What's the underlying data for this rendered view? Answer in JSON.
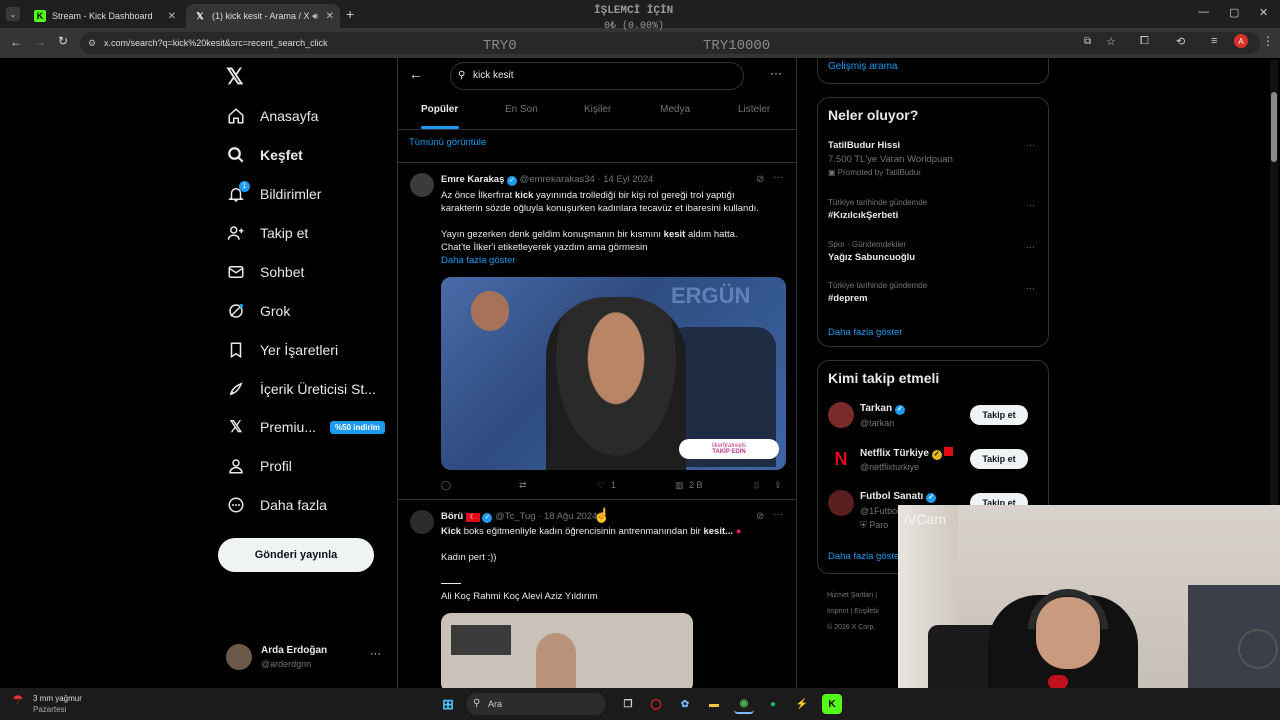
{
  "browser": {
    "tabs": [
      {
        "title": "Stream - Kick Dashboard",
        "active": false
      },
      {
        "title": "(1) kick kesit - Arama / X",
        "active": true
      }
    ],
    "url": "x.com/search?q=kick%20kesit&src=recent_search_click"
  },
  "overlay": {
    "cpu_title": "İŞLEMCİ İÇİN",
    "cpu_value": "0₺ (0.00%)",
    "left_label": "TRY0",
    "right_label": "TRY10000",
    "cam_label": "iVCam"
  },
  "nav": {
    "items": [
      {
        "label": "Anasayfa",
        "icon": "home-icon",
        "bold": false
      },
      {
        "label": "Keşfet",
        "icon": "search-icon",
        "bold": true
      },
      {
        "label": "Bildirimler",
        "icon": "bell-icon",
        "bold": false,
        "badge": "1"
      },
      {
        "label": "Takip et",
        "icon": "person-add-icon",
        "bold": false
      },
      {
        "label": "Sohbet",
        "icon": "mail-icon",
        "bold": false
      },
      {
        "label": "Grok",
        "icon": "grok-icon",
        "bold": false
      },
      {
        "label": "Yer İşaretleri",
        "icon": "bookmark-icon",
        "bold": false
      },
      {
        "label": "İçerik Üreticisi St...",
        "icon": "rocket-icon",
        "bold": false
      },
      {
        "label": "Premiu...",
        "icon": "x-logo-icon",
        "bold": false,
        "pill": "%50 indirim"
      },
      {
        "label": "Profil",
        "icon": "profile-icon",
        "bold": false
      },
      {
        "label": "Daha fazla",
        "icon": "more-circle-icon",
        "bold": false
      }
    ],
    "post_button": "Gönderi yayınla",
    "account": {
      "name": "Arda Erdoğan",
      "handle": "@arderdgnn"
    }
  },
  "search": {
    "query": "kick kesit",
    "tabs": [
      "Popüler",
      "En Son",
      "Kişiler",
      "Medya",
      "Listeler"
    ],
    "see_all": "Tümünü görüntüle"
  },
  "tweets": [
    {
      "name": "Emre Karakaş",
      "handle": "@emrekarakas34",
      "date": "14 Eyl 2024",
      "line1_pre": "Az önce İlkerfırat ",
      "line1_kw": "kick",
      "line1_post": " yayınında trollediğí bir kişi rol gereği trol yaptığı",
      "line2": "karakterin sözde oğluyla konuşurken kadınlara tecavüz et ibaresini kullandı.",
      "line3_pre": "Yayın gezerken denk geldim konuşmanın bir kısmını ",
      "line3_kw": "kesit",
      "line3_post": " aldım hatta.",
      "line4": "Chat'te İlker'i etiketleyerek yazdım ama görmesin",
      "more": "Daha fazla göster",
      "media_overlay_1": "ilkerfiratreels",
      "media_overlay_2": "TAKİP EDİN",
      "media_logo": "ERGÜN",
      "likes": "1",
      "views": "2 B"
    },
    {
      "name": "Börü",
      "handle": "@Tc_Tug",
      "date": "18 Ağu 2024",
      "line1_kw": "Kick",
      "line1_post": " boks eğitmenliyle kadın öğrencisinin antrenmanından bir ",
      "line1_kw2": "kesit...",
      "line2": "Kadın pert :))",
      "line3": "Ali Koç Rahmi Koç Alevi Aziz Yıldırım"
    }
  ],
  "right": {
    "advanced_search": "Gelişmiş arama",
    "trends_title": "Neler oluyor?",
    "trends": [
      {
        "context": "",
        "title": "TatilBudur Hissi",
        "sub": "7.500 TL'ye Varan Worldpuan",
        "promo": "Promoted by TatilBudur"
      },
      {
        "context": "Türkiye tarihinde gündemde",
        "title": "#KızılcıkŞerbeti"
      },
      {
        "context": "Spor · Gündemdekiler",
        "title": "Yağız Sabuncuoğlu"
      },
      {
        "context": "Türkiye tarihinde gündemde",
        "title": "#deprem"
      }
    ],
    "show_more": "Daha fazla göster",
    "who_title": "Kimi takip etmeli",
    "who": [
      {
        "name": "Tarkan",
        "handle": "@tarkan"
      },
      {
        "name": "Netflix Türkiye",
        "handle": "@netflixturkiye"
      },
      {
        "name": "Futbol Sanatı",
        "handle": "@1Futbol",
        "sub": "Paro"
      }
    ],
    "follow_label": "Takip et",
    "show_more_2": "Daha fazla göster",
    "footer": [
      "Hizmet Şartları",
      "Imprint",
      "Erişilebi",
      "© 2026 X Corp."
    ]
  },
  "taskbar": {
    "weather": "3 mm yağmur",
    "weather_sub": "Pazartesi",
    "search": "Ara"
  },
  "colors": {
    "accent": "#1d9bf0",
    "bg": "#000000",
    "border": "#2f3336"
  }
}
